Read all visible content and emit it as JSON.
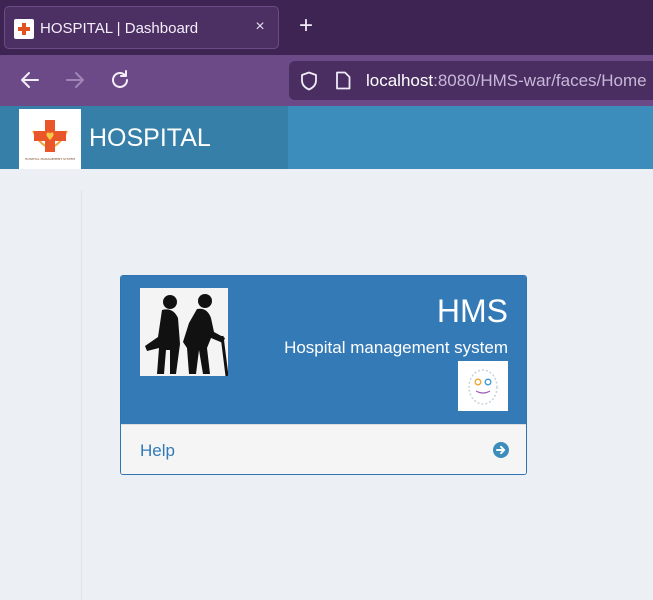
{
  "browser": {
    "tab_title": "HOSPITAL | Dashboard",
    "close_glyph": "×",
    "new_tab_glyph": "+",
    "url_host": "localhost",
    "url_rest": ":8080/HMS-war/faces/Home",
    "icons": [
      "back-arrow-icon",
      "forward-arrow-icon",
      "reload-icon",
      "shield-icon",
      "page-icon"
    ]
  },
  "header": {
    "brand_title": "HOSPITAL",
    "logo_caption": "HOSPITAL MANAGEMENT SYSTEM",
    "colors": {
      "bar": "#3c8dbc",
      "brand": "#367fa9"
    }
  },
  "widget": {
    "title": "HMS",
    "subtitle": "Hospital management system",
    "footer_link": "Help",
    "colors": {
      "head": "#337ab7",
      "footer": "#f5f5f5"
    }
  }
}
